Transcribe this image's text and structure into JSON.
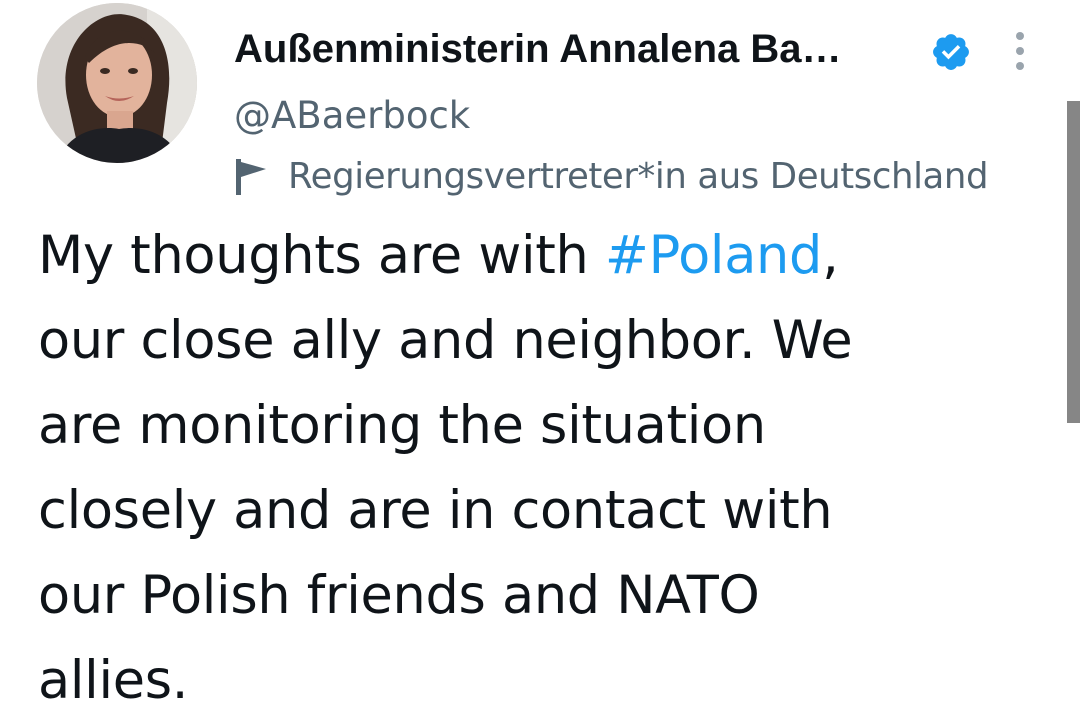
{
  "tweet_header": {
    "display_name": "Außenministerin Annalena Ba…",
    "handle": "@ABaerbock",
    "account_label": "Regierungsvertreter*in aus Deutschland"
  },
  "tweet": {
    "line1_before": "My thoughts are with ",
    "hashtag": "#Poland",
    "line1_after": ",",
    "line2": "our close ally and neighbor. We",
    "line3": "are monitoring the situation",
    "line4": "closely and are in contact with",
    "line5": "our Polish friends and NATO",
    "line6": "allies."
  },
  "icons": {
    "verified": "verified-badge-icon",
    "more": "more-options-icon",
    "label": "government-flag-icon"
  },
  "colors": {
    "text": "#0f1419",
    "secondary_text": "#536471",
    "hashtag": "#1d9bf0",
    "verified_badge": "#1d9bf0"
  }
}
